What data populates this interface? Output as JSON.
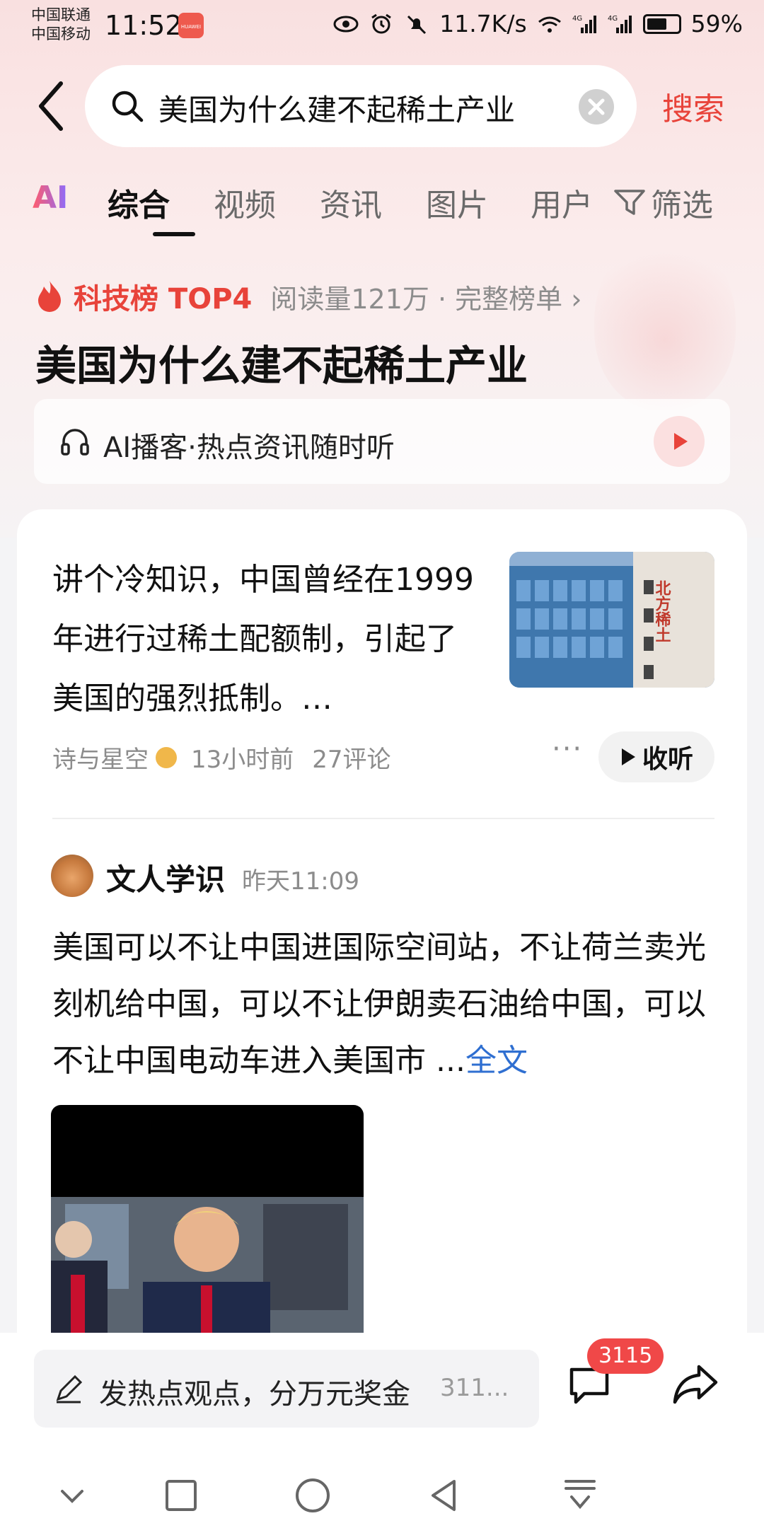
{
  "status_bar": {
    "carrier_1": "中国联通",
    "carrier_2": "中国移动",
    "time": "11:52",
    "network_speed": "11.7K/s",
    "battery": "59%",
    "battery_level": 0.59
  },
  "search": {
    "query": "美国为什么建不起稀土产业",
    "button_label": "搜索"
  },
  "tabs": {
    "ai_label": "AI",
    "items": [
      "综合",
      "视频",
      "资讯",
      "图片",
      "用户"
    ],
    "active": "综合",
    "filter_label": "筛选"
  },
  "hot_rank": {
    "tag": "科技榜 TOP4",
    "meta": "阅读量121万 · 完整榜单 ›"
  },
  "page_title": "美国为什么建不起稀土产业",
  "podcast": {
    "label": "AI播客·热点资讯随时听"
  },
  "article": {
    "text": "讲个冷知识，中国曾经在1999年进行过稀土配额制，引起了美国的强烈抵制。…",
    "thumb_sign": "北方稀土",
    "author": "诗与星空",
    "time": "13小时前",
    "comments": "27评论",
    "more": "···",
    "listen_label": "收听"
  },
  "post": {
    "author": "文人学识",
    "time": "昨天11:09",
    "body": "美国可以不让中国进国际空间站，不让荷兰卖光刻机给中国，可以不让伊朗卖石油给中国，可以不让中国电动车进入美国市 ...",
    "full_text_label": "全文"
  },
  "bottom_bar": {
    "comment_hint": "发热点观点，分万元奖金",
    "comment_count_preview": "311...",
    "badge_count": "3115"
  },
  "colors": {
    "accent": "#e8433a",
    "link": "#2f6fd1",
    "badge": "#f04848"
  }
}
